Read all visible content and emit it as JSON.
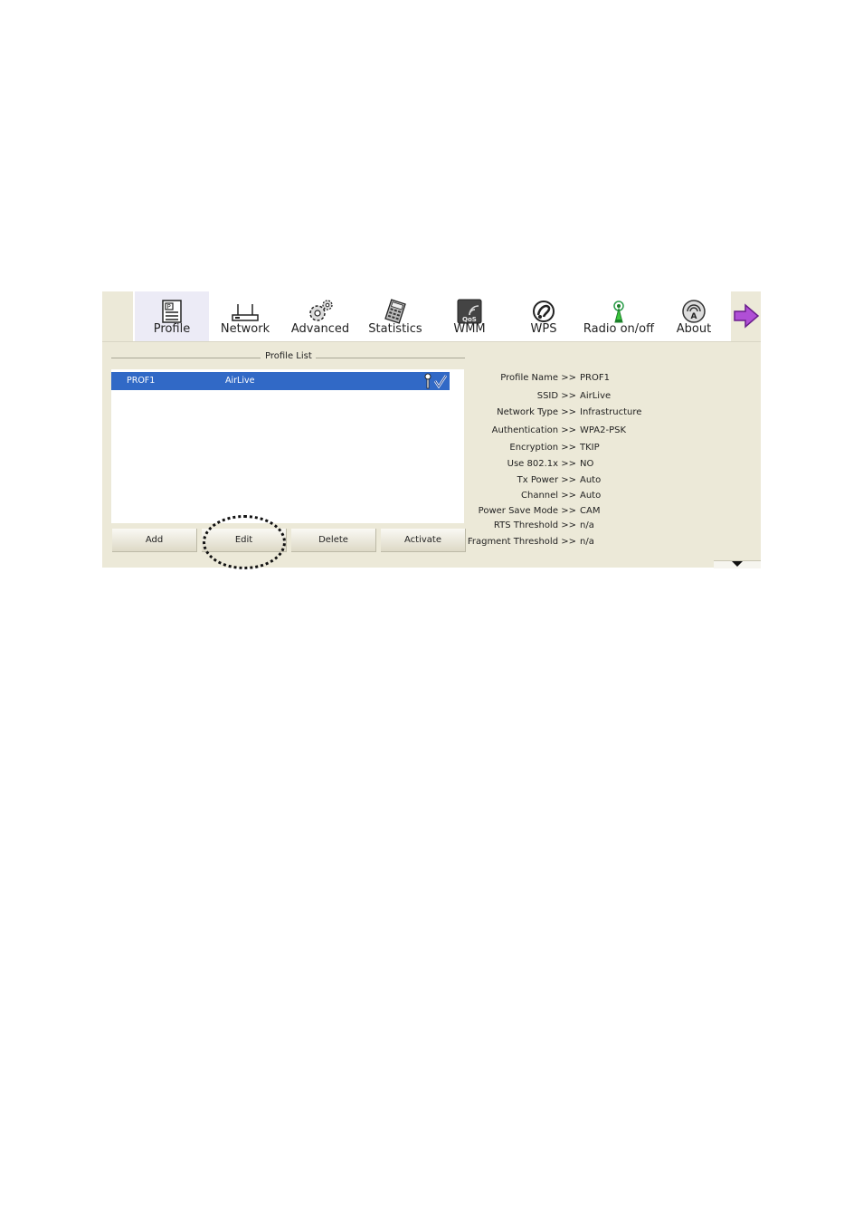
{
  "toolbar": {
    "items": [
      {
        "label": "Profile",
        "icon": "profile-icon"
      },
      {
        "label": "Network",
        "icon": "router-icon"
      },
      {
        "label": "Advanced",
        "icon": "gears-icon"
      },
      {
        "label": "Statistics",
        "icon": "calculator-icon"
      },
      {
        "label": "WMM",
        "icon": "qos-icon"
      },
      {
        "label": "WPS",
        "icon": "wps-icon"
      },
      {
        "label": "Radio on/off",
        "icon": "radio-antenna-icon"
      },
      {
        "label": "About",
        "icon": "about-icon"
      }
    ],
    "next_icon": "right-arrow-icon"
  },
  "profile_list": {
    "legend": "Profile List",
    "rows": [
      {
        "name": "PROF1",
        "ssid": "AirLive"
      }
    ],
    "buttons": {
      "add": "Add",
      "edit": "Edit",
      "delete": "Delete",
      "activate": "Activate"
    }
  },
  "details": [
    {
      "key": "Profile Name >>",
      "value": "PROF1"
    },
    {
      "key": "SSID >>",
      "value": "AirLive"
    },
    {
      "key": "Network Type >>",
      "value": "Infrastructure"
    },
    {
      "key": "Authentication >>",
      "value": "WPA2-PSK"
    },
    {
      "key": "Encryption >>",
      "value": "TKIP"
    },
    {
      "key": "Use 802.1x >>",
      "value": "NO"
    },
    {
      "key": "Tx Power >>",
      "value": "Auto"
    },
    {
      "key": "Channel >>",
      "value": "Auto"
    },
    {
      "key": "Power Save Mode >>",
      "value": "CAM"
    },
    {
      "key": "RTS Threshold >>",
      "value": "n/a"
    },
    {
      "key": "Fragment Threshold >>",
      "value": "n/a"
    }
  ],
  "colors": {
    "selection": "#3169c6",
    "panel": "#ece9d8",
    "accent_arrow": "#9b2fc9"
  }
}
